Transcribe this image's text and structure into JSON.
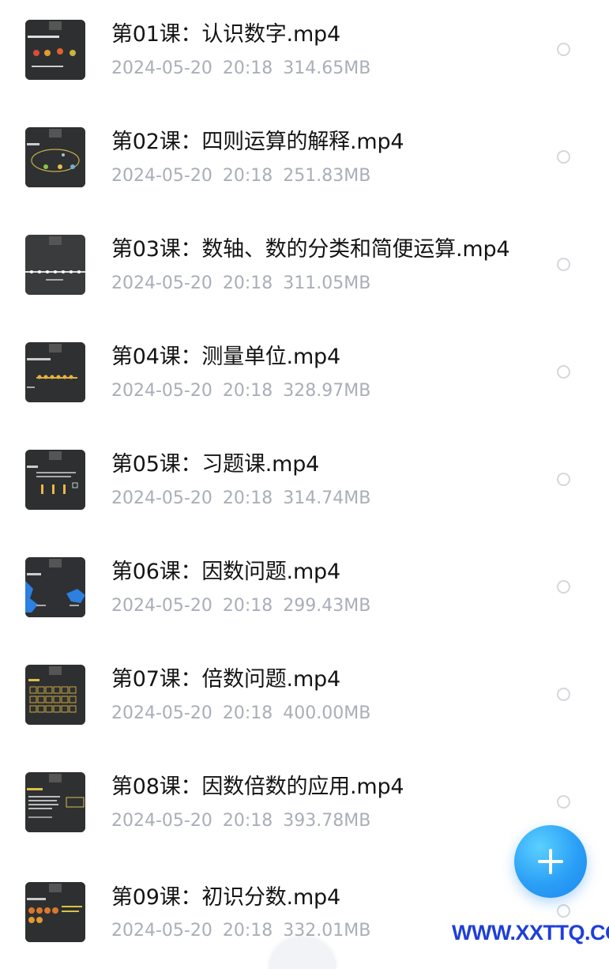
{
  "files": [
    {
      "name": "第01课：认识数字.mp4",
      "date": "2024-05-20",
      "time": "20:18",
      "size": "314.65MB",
      "thumbnail": "thumb-01"
    },
    {
      "name": "第02课：四则运算的解释.mp4",
      "date": "2024-05-20",
      "time": "20:18",
      "size": "251.83MB",
      "thumbnail": "thumb-02"
    },
    {
      "name": "第03课：数轴、数的分类和简便运算.mp4",
      "date": "2024-05-20",
      "time": "20:18",
      "size": "311.05MB",
      "thumbnail": "thumb-03"
    },
    {
      "name": "第04课：测量单位.mp4",
      "date": "2024-05-20",
      "time": "20:18",
      "size": "328.97MB",
      "thumbnail": "thumb-04"
    },
    {
      "name": "第05课：习题课.mp4",
      "date": "2024-05-20",
      "time": "20:18",
      "size": "314.74MB",
      "thumbnail": "thumb-05"
    },
    {
      "name": "第06课：因数问题.mp4",
      "date": "2024-05-20",
      "time": "20:18",
      "size": "299.43MB",
      "thumbnail": "thumb-06"
    },
    {
      "name": "第07课：倍数问题.mp4",
      "date": "2024-05-20",
      "time": "20:18",
      "size": "400.00MB",
      "thumbnail": "thumb-07"
    },
    {
      "name": "第08课：因数倍数的应用.mp4",
      "date": "2024-05-20",
      "time": "20:18",
      "size": "393.78MB",
      "thumbnail": "thumb-08"
    },
    {
      "name": "第09课：初识分数.mp4",
      "date": "2024-05-20",
      "time": "20:18",
      "size": "332.01MB",
      "thumbnail": "thumb-09"
    }
  ],
  "fab": {
    "icon": "plus-icon",
    "color": "#2a9ff6"
  },
  "watermark": {
    "text": "WWW.XXTTQ.COM",
    "color": "#1f3fd9"
  },
  "colors": {
    "title": "#141414",
    "meta": "#a9aeb8",
    "radio": "#d5d7dc"
  }
}
